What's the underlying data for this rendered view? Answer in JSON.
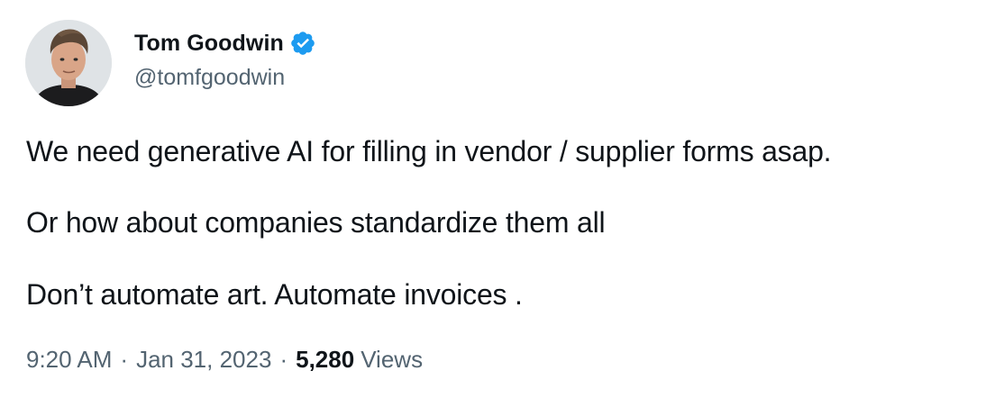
{
  "author": {
    "display_name": "Tom Goodwin",
    "handle": "@tomfgoodwin",
    "verified": true,
    "verified_color": "#1d9bf0"
  },
  "tweet": {
    "lines": [
      "We need generative AI for filling in vendor / supplier forms asap.",
      "Or how about companies standardize them all",
      "Don’t automate art. Automate invoices ."
    ]
  },
  "meta": {
    "time": "9:20 AM",
    "separator": "·",
    "date": "Jan 31, 2023",
    "views_count": "5,280",
    "views_label": "Views"
  },
  "colors": {
    "text_primary": "#0f1419",
    "text_secondary": "#536471"
  }
}
